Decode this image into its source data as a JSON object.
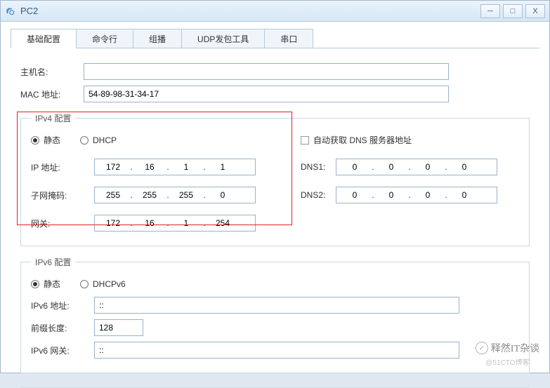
{
  "window": {
    "title": "PC2"
  },
  "tabs": [
    "基础配置",
    "命令行",
    "组播",
    "UDP发包工具",
    "串口"
  ],
  "basic": {
    "hostname_label": "主机名:",
    "hostname_value": "",
    "mac_label": "MAC 地址:",
    "mac_value": "54-89-98-31-34-17"
  },
  "ipv4": {
    "legend": "IPv4 配置",
    "static_label": "静态",
    "dhcp_label": "DHCP",
    "auto_dns_label": "自动获取 DNS 服务器地址",
    "ip_label": "IP 地址:",
    "ip": [
      "172",
      "16",
      "1",
      "1"
    ],
    "mask_label": "子网掩码:",
    "mask": [
      "255",
      "255",
      "255",
      "0"
    ],
    "gw_label": "网关:",
    "gw": [
      "172",
      "16",
      "1",
      "254"
    ],
    "dns1_label": "DNS1:",
    "dns1": [
      "0",
      "0",
      "0",
      "0"
    ],
    "dns2_label": "DNS2:",
    "dns2": [
      "0",
      "0",
      "0",
      "0"
    ]
  },
  "ipv6": {
    "legend": "IPv6 配置",
    "static_label": "静态",
    "dhcpv6_label": "DHCPv6",
    "addr_label": "IPv6 地址:",
    "addr_value": "::",
    "prefix_label": "前缀长度:",
    "prefix_value": "128",
    "gw_label": "IPv6 网关:",
    "gw_value": "::"
  },
  "watermark": {
    "brand": "释然IT杂谈",
    "sub": "@51CTO博客"
  }
}
